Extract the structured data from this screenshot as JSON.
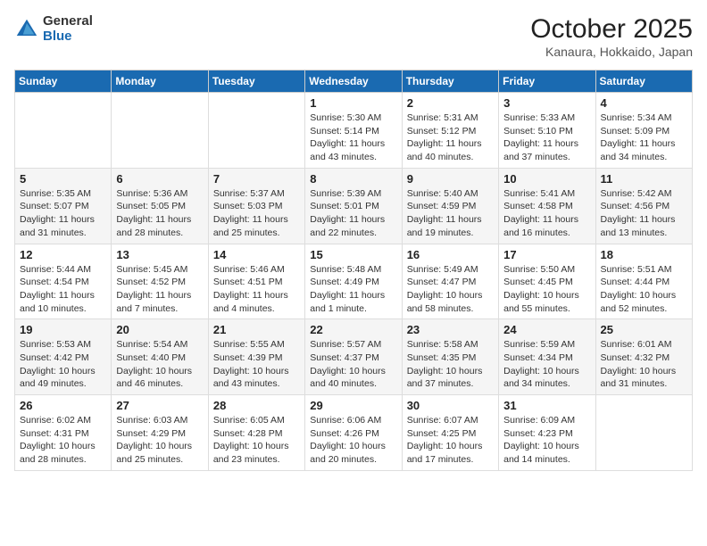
{
  "header": {
    "logo_general": "General",
    "logo_blue": "Blue",
    "month_title": "October 2025",
    "location": "Kanaura, Hokkaido, Japan"
  },
  "weekdays": [
    "Sunday",
    "Monday",
    "Tuesday",
    "Wednesday",
    "Thursday",
    "Friday",
    "Saturday"
  ],
  "weeks": [
    [
      {
        "day": "",
        "info": ""
      },
      {
        "day": "",
        "info": ""
      },
      {
        "day": "",
        "info": ""
      },
      {
        "day": "1",
        "info": "Sunrise: 5:30 AM\nSunset: 5:14 PM\nDaylight: 11 hours\nand 43 minutes."
      },
      {
        "day": "2",
        "info": "Sunrise: 5:31 AM\nSunset: 5:12 PM\nDaylight: 11 hours\nand 40 minutes."
      },
      {
        "day": "3",
        "info": "Sunrise: 5:33 AM\nSunset: 5:10 PM\nDaylight: 11 hours\nand 37 minutes."
      },
      {
        "day": "4",
        "info": "Sunrise: 5:34 AM\nSunset: 5:09 PM\nDaylight: 11 hours\nand 34 minutes."
      }
    ],
    [
      {
        "day": "5",
        "info": "Sunrise: 5:35 AM\nSunset: 5:07 PM\nDaylight: 11 hours\nand 31 minutes."
      },
      {
        "day": "6",
        "info": "Sunrise: 5:36 AM\nSunset: 5:05 PM\nDaylight: 11 hours\nand 28 minutes."
      },
      {
        "day": "7",
        "info": "Sunrise: 5:37 AM\nSunset: 5:03 PM\nDaylight: 11 hours\nand 25 minutes."
      },
      {
        "day": "8",
        "info": "Sunrise: 5:39 AM\nSunset: 5:01 PM\nDaylight: 11 hours\nand 22 minutes."
      },
      {
        "day": "9",
        "info": "Sunrise: 5:40 AM\nSunset: 4:59 PM\nDaylight: 11 hours\nand 19 minutes."
      },
      {
        "day": "10",
        "info": "Sunrise: 5:41 AM\nSunset: 4:58 PM\nDaylight: 11 hours\nand 16 minutes."
      },
      {
        "day": "11",
        "info": "Sunrise: 5:42 AM\nSunset: 4:56 PM\nDaylight: 11 hours\nand 13 minutes."
      }
    ],
    [
      {
        "day": "12",
        "info": "Sunrise: 5:44 AM\nSunset: 4:54 PM\nDaylight: 11 hours\nand 10 minutes."
      },
      {
        "day": "13",
        "info": "Sunrise: 5:45 AM\nSunset: 4:52 PM\nDaylight: 11 hours\nand 7 minutes."
      },
      {
        "day": "14",
        "info": "Sunrise: 5:46 AM\nSunset: 4:51 PM\nDaylight: 11 hours\nand 4 minutes."
      },
      {
        "day": "15",
        "info": "Sunrise: 5:48 AM\nSunset: 4:49 PM\nDaylight: 11 hours\nand 1 minute."
      },
      {
        "day": "16",
        "info": "Sunrise: 5:49 AM\nSunset: 4:47 PM\nDaylight: 10 hours\nand 58 minutes."
      },
      {
        "day": "17",
        "info": "Sunrise: 5:50 AM\nSunset: 4:45 PM\nDaylight: 10 hours\nand 55 minutes."
      },
      {
        "day": "18",
        "info": "Sunrise: 5:51 AM\nSunset: 4:44 PM\nDaylight: 10 hours\nand 52 minutes."
      }
    ],
    [
      {
        "day": "19",
        "info": "Sunrise: 5:53 AM\nSunset: 4:42 PM\nDaylight: 10 hours\nand 49 minutes."
      },
      {
        "day": "20",
        "info": "Sunrise: 5:54 AM\nSunset: 4:40 PM\nDaylight: 10 hours\nand 46 minutes."
      },
      {
        "day": "21",
        "info": "Sunrise: 5:55 AM\nSunset: 4:39 PM\nDaylight: 10 hours\nand 43 minutes."
      },
      {
        "day": "22",
        "info": "Sunrise: 5:57 AM\nSunset: 4:37 PM\nDaylight: 10 hours\nand 40 minutes."
      },
      {
        "day": "23",
        "info": "Sunrise: 5:58 AM\nSunset: 4:35 PM\nDaylight: 10 hours\nand 37 minutes."
      },
      {
        "day": "24",
        "info": "Sunrise: 5:59 AM\nSunset: 4:34 PM\nDaylight: 10 hours\nand 34 minutes."
      },
      {
        "day": "25",
        "info": "Sunrise: 6:01 AM\nSunset: 4:32 PM\nDaylight: 10 hours\nand 31 minutes."
      }
    ],
    [
      {
        "day": "26",
        "info": "Sunrise: 6:02 AM\nSunset: 4:31 PM\nDaylight: 10 hours\nand 28 minutes."
      },
      {
        "day": "27",
        "info": "Sunrise: 6:03 AM\nSunset: 4:29 PM\nDaylight: 10 hours\nand 25 minutes."
      },
      {
        "day": "28",
        "info": "Sunrise: 6:05 AM\nSunset: 4:28 PM\nDaylight: 10 hours\nand 23 minutes."
      },
      {
        "day": "29",
        "info": "Sunrise: 6:06 AM\nSunset: 4:26 PM\nDaylight: 10 hours\nand 20 minutes."
      },
      {
        "day": "30",
        "info": "Sunrise: 6:07 AM\nSunset: 4:25 PM\nDaylight: 10 hours\nand 17 minutes."
      },
      {
        "day": "31",
        "info": "Sunrise: 6:09 AM\nSunset: 4:23 PM\nDaylight: 10 hours\nand 14 minutes."
      },
      {
        "day": "",
        "info": ""
      }
    ]
  ]
}
